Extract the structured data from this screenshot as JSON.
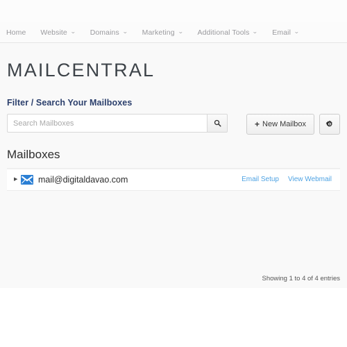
{
  "nav": {
    "items": [
      {
        "label": "Home",
        "has_caret": false
      },
      {
        "label": "Website",
        "has_caret": true
      },
      {
        "label": "Domains",
        "has_caret": true
      },
      {
        "label": "Marketing",
        "has_caret": true
      },
      {
        "label": "Additional Tools",
        "has_caret": true
      },
      {
        "label": "Email",
        "has_caret": true
      }
    ],
    "caret_glyph": "⌄"
  },
  "header": {
    "brand_title": "MAILCENTRAL"
  },
  "filter": {
    "section_label": "Filter / Search Your Mailboxes",
    "search_value": "",
    "search_placeholder": "Search Mailboxes",
    "search_icon": "search-icon"
  },
  "toolbar": {
    "new_mailbox_label": "New Mailbox",
    "new_mailbox_plus": "+",
    "settings_icon": "gear-icon"
  },
  "mailboxes": {
    "heading": "Mailboxes",
    "expand_glyph": "▶",
    "rows": [
      {
        "address": "mail@digitaldavao.com",
        "icon": "envelope-icon",
        "links": [
          {
            "label": "Email Setup"
          },
          {
            "label": "View Webmail"
          }
        ]
      }
    ],
    "entries_info": "Showing 1 to 4 of 4 entries"
  },
  "colors": {
    "brand_text": "#3d4349",
    "section_label": "#2b3f6c",
    "link_blue": "#4fa3e3",
    "envelope_blue": "#2b7fd4",
    "page_bg": "#f9f9f9",
    "nav_text": "#9a9a9e"
  }
}
